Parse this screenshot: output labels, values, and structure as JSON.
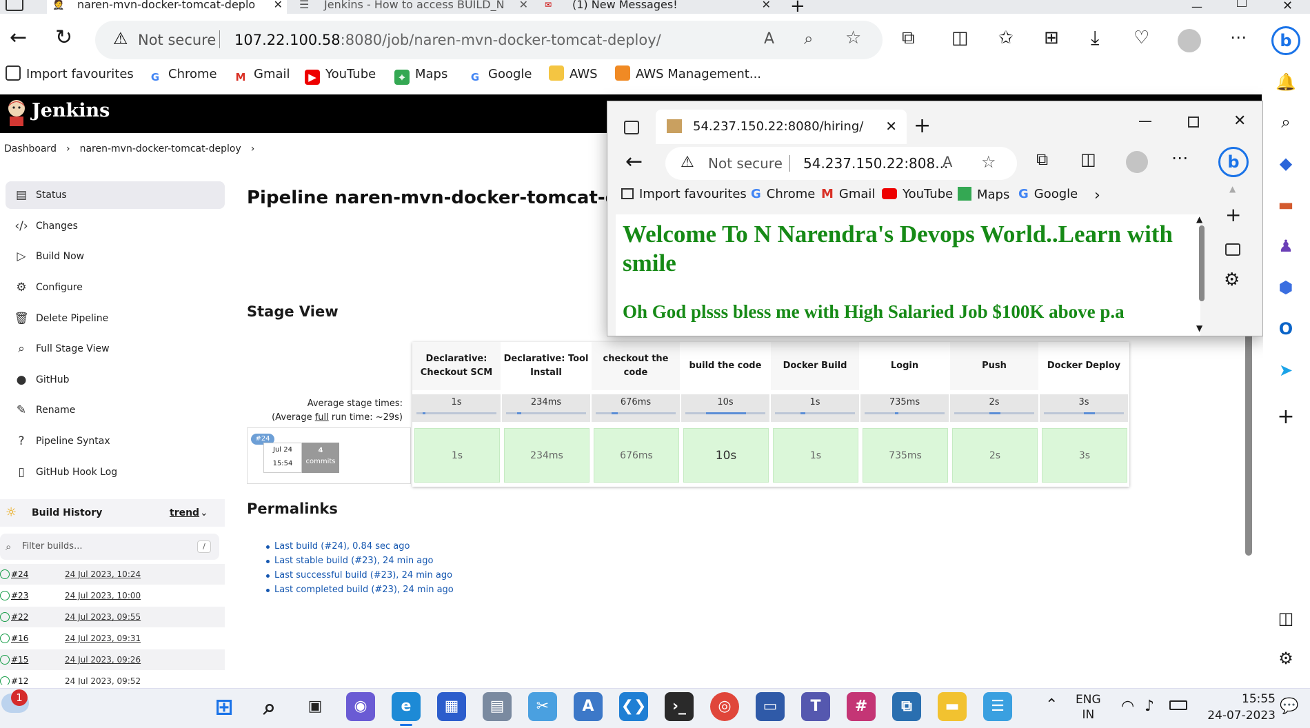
{
  "browser": {
    "tabs": [
      {
        "title": "naren-mvn-docker-tomcat-deplo"
      },
      {
        "title": "Jenkins - How to access BUILD_N"
      },
      {
        "title": "(1) New Messages!"
      }
    ],
    "security_label": "Not secure",
    "url_host": "107.22.100.58",
    "url_rest": ":8080/job/naren-mvn-docker-tomcat-deploy/",
    "favourites": [
      "Import favourites",
      "Chrome",
      "Gmail",
      "YouTube",
      "Maps",
      "Google",
      "AWS",
      "AWS Management..."
    ]
  },
  "jenkins": {
    "brand": "Jenkins",
    "breadcrumb": [
      "Dashboard",
      "naren-mvn-docker-tomcat-deploy"
    ],
    "sidebar": [
      {
        "label": "Status",
        "icon": "document-icon"
      },
      {
        "label": "Changes",
        "icon": "code-icon"
      },
      {
        "label": "Build Now",
        "icon": "play-icon"
      },
      {
        "label": "Configure",
        "icon": "gear-icon"
      },
      {
        "label": "Delete Pipeline",
        "icon": "trash-icon"
      },
      {
        "label": "Full Stage View",
        "icon": "search-icon"
      },
      {
        "label": "GitHub",
        "icon": "github-icon"
      },
      {
        "label": "Rename",
        "icon": "pencil-icon"
      },
      {
        "label": "Pipeline Syntax",
        "icon": "help-icon"
      },
      {
        "label": "GitHub Hook Log",
        "icon": "document-icon"
      }
    ],
    "build_history": {
      "title": "Build History",
      "trend_label": "trend",
      "filter_placeholder": "Filter builds...",
      "filter_shortcut": "/",
      "builds": [
        {
          "num": "#24",
          "date": "24 Jul 2023, 10:24"
        },
        {
          "num": "#23",
          "date": "24 Jul 2023, 10:00"
        },
        {
          "num": "#22",
          "date": "24 Jul 2023, 09:55"
        },
        {
          "num": "#16",
          "date": "24 Jul 2023, 09:31"
        },
        {
          "num": "#15",
          "date": "24 Jul 2023, 09:26"
        },
        {
          "num": "#12",
          "date": "24 Jul 2023, 09:52"
        }
      ]
    },
    "page_title": "Pipeline naren-mvn-docker-tomcat-deploy",
    "stage_view_title": "Stage View",
    "avg_label_1": "Average stage times:",
    "avg_label_2a": "(Average ",
    "avg_label_2b": "full",
    "avg_label_2c": " run time: ~29s)",
    "build": {
      "badge": "#24",
      "month_day": "Jul 24",
      "time": "15:54",
      "commits_count": "4",
      "commits_label": "commits"
    },
    "stages": [
      {
        "name": "Declarative: Checkout SCM",
        "avg": "1s",
        "cell": "1s",
        "bar": 0.02
      },
      {
        "name": "Declarative: Tool Install",
        "avg": "234ms",
        "cell": "234ms",
        "bar": 0.05
      },
      {
        "name": "checkout the code",
        "avg": "676ms",
        "cell": "676ms",
        "bar": 0.08
      },
      {
        "name": "build the code",
        "avg": "10s",
        "cell": "10s",
        "bar": 0.5
      },
      {
        "name": "Docker Build",
        "avg": "1s",
        "cell": "1s",
        "bar": 0.06
      },
      {
        "name": "Login",
        "avg": "735ms",
        "cell": "735ms",
        "bar": 0.04
      },
      {
        "name": "Push",
        "avg": "2s",
        "cell": "2s",
        "bar": 0.14
      },
      {
        "name": "Docker Deploy",
        "avg": "3s",
        "cell": "3s",
        "bar": 0.14
      }
    ],
    "permalinks_title": "Permalinks",
    "permalinks": [
      "Last build (#24), 0.84 sec ago",
      "Last stable build (#23), 24 min ago",
      "Last successful build (#23), 24 min ago",
      "Last completed build (#23), 24 min ago"
    ]
  },
  "popup": {
    "tab_title": "54.237.150.22:8080/hiring/",
    "security_label": "Not secure",
    "url": "54.237.150.22:808...",
    "favourites": [
      "Import favourites",
      "Chrome",
      "Gmail",
      "YouTube",
      "Maps",
      "Google"
    ],
    "heading": "Welcome To N Narendra's Devops World..Learn with smile",
    "subheading": "Oh God plsss bless me with High Salaried Job $100K above p.a"
  },
  "taskbar": {
    "notification_count": "1",
    "lang_line1": "ENG",
    "lang_line2": "IN",
    "time": "15:55",
    "date": "24-07-2023"
  }
}
